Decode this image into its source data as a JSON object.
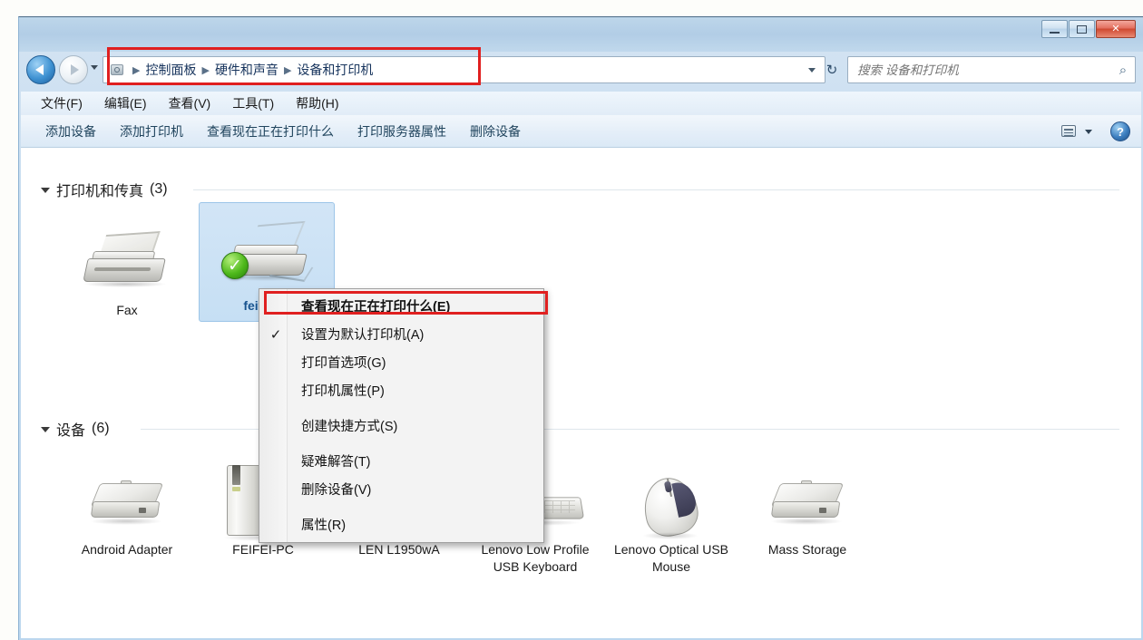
{
  "window": {
    "controls": {
      "minimize_label": "—",
      "maximize_label": "",
      "close_label": "✕"
    }
  },
  "address_bar": {
    "breadcrumbs": [
      {
        "label": "控制面板"
      },
      {
        "label": "硬件和声音"
      },
      {
        "label": "设备和打印机"
      }
    ],
    "separator": "▶",
    "dropdown_icon": "chevron-down-icon",
    "refresh_icon": "refresh-icon",
    "refresh_glyph": "↻"
  },
  "search": {
    "placeholder": "搜索 设备和打印机",
    "value": "",
    "icon": "search-icon",
    "glyph": "⌕"
  },
  "menubar": {
    "items": [
      {
        "label": "文件(F)"
      },
      {
        "label": "编辑(E)"
      },
      {
        "label": "查看(V)"
      },
      {
        "label": "工具(T)"
      },
      {
        "label": "帮助(H)"
      }
    ]
  },
  "toolbar": {
    "items": [
      {
        "label": "添加设备"
      },
      {
        "label": "添加打印机"
      },
      {
        "label": "查看现在正在打印什么"
      },
      {
        "label": "打印服务器属性"
      },
      {
        "label": "删除设备"
      }
    ],
    "view_icon": "view-options-icon",
    "help_label": "?"
  },
  "groups": [
    {
      "name": "printers",
      "title": "打印机和传真",
      "count": "(3)"
    },
    {
      "name": "devices",
      "title": "设备",
      "count": "(6)"
    }
  ],
  "printers": [
    {
      "label": "Fax",
      "icon": "fax-icon",
      "selected": false,
      "default": false
    },
    {
      "label": "feifeiPri",
      "icon": "printer-icon",
      "selected": true,
      "default": true,
      "default_badge": "✓"
    }
  ],
  "devices": [
    {
      "label": "Android Adapter",
      "icon": "external-drive-icon"
    },
    {
      "label": "FEIFEI-PC",
      "icon": "computer-icon"
    },
    {
      "label": "LEN L1950wA",
      "icon": "monitor-icon"
    },
    {
      "label": "Lenovo Low Profile USB Keyboard",
      "icon": "keyboard-icon"
    },
    {
      "label": "Lenovo Optical USB Mouse",
      "icon": "mouse-icon"
    },
    {
      "label": "Mass Storage",
      "icon": "external-drive-icon"
    }
  ],
  "context_menu": {
    "items": [
      {
        "label": "查看现在正在打印什么(E)",
        "bold": true,
        "checked": false,
        "highlighted": true
      },
      {
        "label": "设置为默认打印机(A)",
        "bold": false,
        "checked": true,
        "check_glyph": "✓"
      },
      {
        "label": "打印首选项(G)",
        "bold": false,
        "checked": false
      },
      {
        "label": "打印机属性(P)",
        "bold": false,
        "checked": false
      },
      {
        "label": "创建快捷方式(S)",
        "bold": false,
        "checked": false
      },
      {
        "label": "疑难解答(T)",
        "bold": false,
        "checked": false
      },
      {
        "label": "删除设备(V)",
        "bold": false,
        "checked": false
      },
      {
        "label": "属性(R)",
        "bold": false,
        "checked": false
      }
    ]
  },
  "annotations": {
    "accent_color": "#e02020",
    "boxes": [
      {
        "name": "address-bar-highlight"
      },
      {
        "name": "view-print-queue-highlight"
      }
    ]
  }
}
